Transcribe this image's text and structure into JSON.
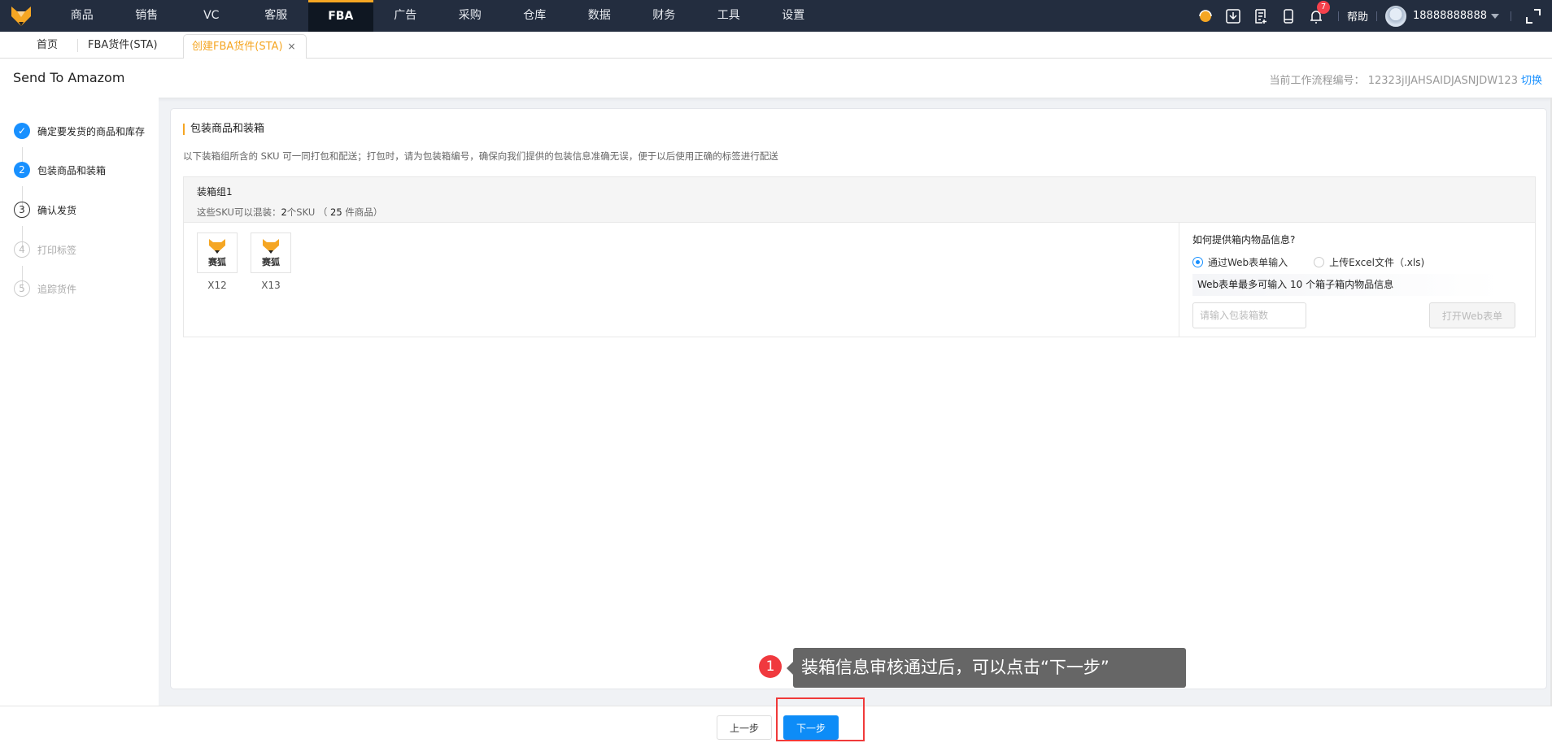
{
  "nav": {
    "menu": [
      "商品",
      "销售",
      "VC",
      "客服",
      "FBA",
      "广告",
      "采购",
      "仓库",
      "数据",
      "财务",
      "工具",
      "设置"
    ],
    "active": "FBA",
    "notification_count": "7",
    "help": "帮助",
    "user": "18888888888"
  },
  "tabs": {
    "home": "首页",
    "fba_shipment": "FBA货件(STA)",
    "create": "创建FBA货件(STA)",
    "close": "×"
  },
  "header": {
    "title": "Send To Amazom",
    "workflow_label": "当前工作流程编号：",
    "workflow_id": "12323jIJAHSAIDJASNJDW123",
    "switch": "切换"
  },
  "steps": [
    {
      "num": "✓",
      "label": "确定要发货的商品和库存",
      "state": "done"
    },
    {
      "num": "2",
      "label": "包装商品和装箱",
      "state": "current"
    },
    {
      "num": "3",
      "label": "确认发货",
      "state": "todo"
    },
    {
      "num": "4",
      "label": "打印标签",
      "state": "disabled"
    },
    {
      "num": "5",
      "label": "追踪货件",
      "state": "disabled"
    }
  ],
  "main": {
    "title": "包装商品和装箱",
    "desc": "以下装箱组所含的 SKU 可一同打包和配送；打包时，请为包装箱编号，确保向我们提供的包装信息准确无误，便于以后使用正确的标签进行配送",
    "group": {
      "name": "装箱组1",
      "sub_prefix": "这些SKU可以混装：",
      "sku_count": "2",
      "sku_label": "个SKU",
      "paren_open": "（",
      "item_count": "25",
      "item_label": "件商品）",
      "products": [
        {
          "logo_text": "赛狐",
          "sku": "X12"
        },
        {
          "logo_text": "赛狐",
          "sku": "X13"
        }
      ]
    },
    "panel": {
      "question": "如何提供箱内物品信息?",
      "option_web": "通过Web表单输入",
      "option_excel": "上传Excel文件（.xls)",
      "info_prefix": "Web表单最多可输入",
      "max_boxes": "10",
      "info_suffix": "个箱子箱内物品信息",
      "input_placeholder": "请输入包装箱数",
      "open_button": "打开Web表单"
    }
  },
  "footer": {
    "prev": "上一步",
    "next": "下一步"
  },
  "tooltip": {
    "num": "1",
    "text": "装箱信息审核通过后，可以点击“下一步”"
  },
  "colors": {
    "accent": "#f5a623",
    "primary": "#1890ff",
    "nav_bg": "#232d3f"
  }
}
